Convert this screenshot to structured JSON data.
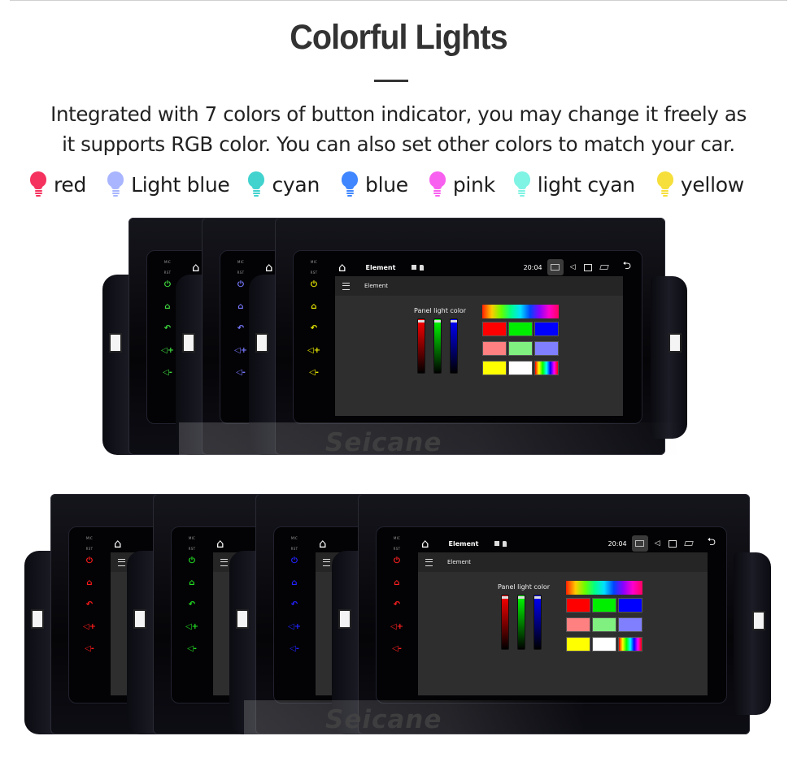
{
  "header": {
    "title": "Colorful Lights",
    "description_line1": "Integrated with 7 colors of button indicator, you may change it freely as",
    "description_line2": "it supports RGB color. You can also set other colors to match your car."
  },
  "legend": [
    {
      "label": "red",
      "color": "#f5325e",
      "icon": "bulb-icon"
    },
    {
      "label": "Light blue",
      "color": "#a9b6ff",
      "icon": "bulb-icon"
    },
    {
      "label": "cyan",
      "color": "#42d3cf",
      "icon": "bulb-icon"
    },
    {
      "label": "blue",
      "color": "#3f86ff",
      "icon": "bulb-icon"
    },
    {
      "label": "pink",
      "color": "#f860ef",
      "icon": "bulb-icon"
    },
    {
      "label": "light cyan",
      "color": "#7ff3e4",
      "icon": "bulb-icon"
    },
    {
      "label": "yellow",
      "color": "#f6df3b",
      "icon": "bulb-icon"
    }
  ],
  "device": {
    "mic_label": "MIC",
    "rst_label": "RST",
    "status_title": "Element",
    "time": "20:04",
    "app_title": "Element",
    "panel_label": "Panel light color",
    "watermark": "Seicane",
    "sliders": [
      {
        "channel": "red",
        "color": "#ff0000"
      },
      {
        "channel": "green",
        "color": "#00ff00"
      },
      {
        "channel": "blue",
        "color": "#0000ff"
      }
    ],
    "swatches": [
      "#ff0000",
      "#00ee00",
      "#0000ff",
      "#ff8080",
      "#80f080",
      "#8080ff",
      "#ffff00",
      "#ffffff",
      "rainbow"
    ]
  },
  "top_group_key_colors": [
    "#3fd93f",
    "#7777ff",
    "#e8e800"
  ],
  "bottom_group_key_colors": [
    "#ff1a1a",
    "#22dd22",
    "#2222ff",
    "#ff2020"
  ]
}
